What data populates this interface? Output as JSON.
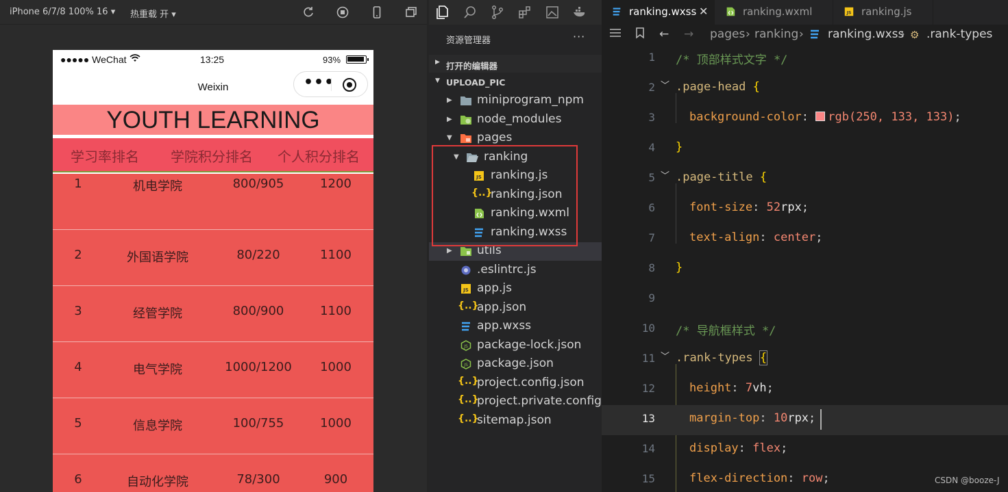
{
  "simulator": {
    "device": "iPhone 6/7/8 100% 16 ▾",
    "hot_reload": "热重载 开 ▾",
    "status": {
      "signal": "●●●●● WeChat",
      "time": "13:25",
      "battery": "93%",
      "battery_level": 0.93
    },
    "nav_title": "Weixin",
    "page_title": "YOUTH LEARNING",
    "rank_tabs": [
      "学习率排名",
      "学院积分排名",
      "个人积分排名"
    ],
    "rows": [
      {
        "rank": "1",
        "name": "机电学院",
        "ratio": "800/905",
        "score": "1200"
      },
      {
        "rank": "2",
        "name": "外国语学院",
        "ratio": "80/220",
        "score": "1100"
      },
      {
        "rank": "3",
        "name": "经管学院",
        "ratio": "800/900",
        "score": "1100"
      },
      {
        "rank": "4",
        "name": "电气学院",
        "ratio": "1000/1200",
        "score": "1000"
      },
      {
        "rank": "5",
        "name": "信息学院",
        "ratio": "100/755",
        "score": "1000"
      },
      {
        "rank": "6",
        "name": "自动化学院",
        "ratio": "78/300",
        "score": "900"
      }
    ]
  },
  "explorer": {
    "title": "资源管理器",
    "more": "···",
    "open_editors": "打开的编辑器",
    "root": "UPLOAD_PIC",
    "items": [
      {
        "label": "miniprogram_npm",
        "icon": "folder-icon"
      },
      {
        "label": "node_modules",
        "icon": "node-folder-icon"
      },
      {
        "label": "pages",
        "icon": "pages-folder-icon"
      },
      {
        "label": "ranking",
        "icon": "folder-open-icon"
      },
      {
        "label": "ranking.js",
        "icon": "js-file-icon"
      },
      {
        "label": "ranking.json",
        "icon": "json-file-icon"
      },
      {
        "label": "ranking.wxml",
        "icon": "wxml-file-icon"
      },
      {
        "label": "ranking.wxss",
        "icon": "wxss-file-icon"
      },
      {
        "label": "utils",
        "icon": "utils-folder-icon"
      },
      {
        "label": ".eslintrc.js",
        "icon": "eslint-file-icon"
      },
      {
        "label": "app.js",
        "icon": "js-file-icon"
      },
      {
        "label": "app.json",
        "icon": "json-file-icon"
      },
      {
        "label": "app.wxss",
        "icon": "wxss-file-icon"
      },
      {
        "label": "package-lock.json",
        "icon": "npm-file-icon"
      },
      {
        "label": "package.json",
        "icon": "npm-file-icon"
      },
      {
        "label": "project.config.json",
        "icon": "json-file-icon"
      },
      {
        "label": "project.private.config....",
        "icon": "json-file-icon"
      },
      {
        "label": "sitemap.json",
        "icon": "json-file-icon"
      }
    ]
  },
  "editor": {
    "tabs": [
      {
        "label": "ranking.wxss",
        "icon": "wxss-file-icon",
        "active": true
      },
      {
        "label": "ranking.wxml",
        "icon": "wxml-file-icon",
        "active": false
      },
      {
        "label": "ranking.js",
        "icon": "js-file-icon",
        "active": false
      }
    ],
    "breadcrumb": [
      "pages",
      "ranking",
      "ranking.wxss",
      ".rank-types"
    ],
    "current_line": 13,
    "lines": [
      {
        "n": "1",
        "c": "/* 顶部样式文字 */"
      },
      {
        "n": "2",
        "sel": ".page-head",
        "b": "{"
      },
      {
        "n": "3",
        "p": "background-color",
        "v": "rgb(250, 133, 133)",
        "swatch": "#fa8585"
      },
      {
        "n": "4",
        "b": "}"
      },
      {
        "n": "5",
        "sel": ".page-title",
        "b": "{"
      },
      {
        "n": "6",
        "p": "font-size",
        "num": "52",
        "unit": "rpx"
      },
      {
        "n": "7",
        "p": "text-align",
        "v": "center"
      },
      {
        "n": "8",
        "b": "}"
      },
      {
        "n": "9"
      },
      {
        "n": "10",
        "c": "/* 导航框样式 */"
      },
      {
        "n": "11",
        "sel": ".rank-types",
        "b": "{"
      },
      {
        "n": "12",
        "p": "height",
        "num": "7",
        "unit": "vh"
      },
      {
        "n": "13",
        "p": "margin-top",
        "num": "10",
        "unit": "rpx"
      },
      {
        "n": "14",
        "p": "display",
        "v": "flex"
      },
      {
        "n": "15",
        "p": "flex-direction",
        "v": "row"
      }
    ]
  },
  "watermark": "CSDN @booze-J",
  "colors": {
    "page_head": "#fa8585",
    "rank_types": "#f04f5e",
    "rank_list": "#ec5653",
    "highlight": "#e03a3a"
  }
}
